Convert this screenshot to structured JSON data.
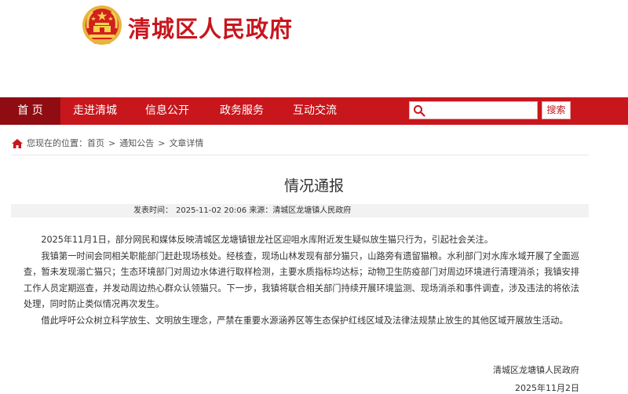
{
  "header": {
    "site_title": "清城区人民政府"
  },
  "nav": {
    "items": [
      {
        "label": "首 页",
        "active": true
      },
      {
        "label": "走进清城",
        "active": false
      },
      {
        "label": "信息公开",
        "active": false
      },
      {
        "label": "政务服务",
        "active": false
      },
      {
        "label": "互动交流",
        "active": false
      }
    ],
    "search": {
      "placeholder": "",
      "button_label": "搜索"
    }
  },
  "breadcrumb": {
    "prefix": "您现在的位置：",
    "items": [
      "首页",
      "通知公告",
      "文章详情"
    ],
    "separator": ">"
  },
  "article": {
    "title": "情况通报",
    "meta": {
      "time_label": "发表时间：",
      "time_value": "2025-11-02 20:06",
      "source_label": "来源：",
      "source_value": "清城区龙塘镇人民政府"
    },
    "paragraphs": [
      "2025年11月1日，部分网民和媒体反映清城区龙塘镇银龙社区迎咀水库附近发生疑似放生猫只行为，引起社会关注。",
      "我镇第一时间会同相关职能部门赶赴现场核处。经核查，现场山林发现有部分猫只，山路旁有遗留猫粮。水利部门对水库水域开展了全面巡查，暂未发现溺亡猫只；生态环境部门对周边水体进行取样检测，主要水质指标均达标；动物卫生防疫部门对周边环境进行清理消杀；我镇安排工作人员定期巡查，并发动周边热心群众认领猫只。下一步，我镇将联合相关部门持续开展环境监测、现场消杀和事件调查，涉及违法的将依法处理，同时防止类似情况再次发生。",
      "借此呼吁公众树立科学放生、文明放生理念，严禁在重要水源涵养区等生态保护红线区域及法律法规禁止放生的其他区域开展放生活动。"
    ],
    "signature": "清城区龙塘镇人民政府",
    "date": "2025年11月2日"
  },
  "colors": {
    "brand_red": "#c8161d",
    "nav_active": "#8f0d12",
    "emblem_gold": "#e8b43a"
  }
}
